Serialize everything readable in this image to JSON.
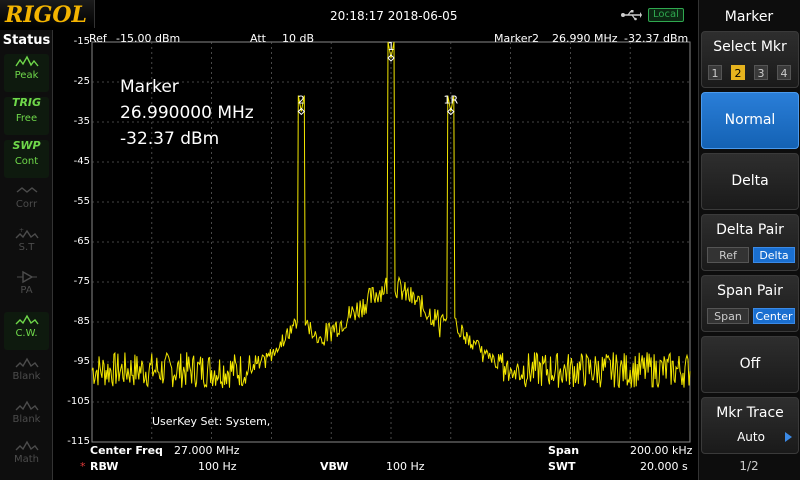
{
  "brand": "RIGOL",
  "datetime": "20:18:17  2018-06-05",
  "remote_status": "Local",
  "status": {
    "title": "Status",
    "items": [
      {
        "icon": "peak-detector-icon",
        "label": "Peak",
        "active": true
      },
      {
        "icon": "TRIG",
        "label": "Free",
        "active": true
      },
      {
        "icon": "SWP",
        "label": "Cont",
        "active": true
      },
      {
        "icon": "correction-icon",
        "label": "Corr",
        "active": false
      },
      {
        "icon": "source-tracking-icon",
        "label": "S.T",
        "active": false
      },
      {
        "icon": "preamp-icon",
        "label": "PA",
        "active": false
      },
      {
        "icon": "cw-signal-icon",
        "label": "C.W.",
        "active": true
      },
      {
        "icon": "blank-trace-icon",
        "label": "Blank",
        "active": false
      },
      {
        "icon": "blank-trace-icon",
        "label": "Blank",
        "active": false
      },
      {
        "icon": "math-trace-icon",
        "label": "Math",
        "active": false
      }
    ]
  },
  "header": {
    "ref_label": "Ref",
    "ref_value": "-15.00 dBm",
    "att_label": "Att",
    "att_value": "10 dB",
    "marker_label": "Marker2",
    "marker_freq": "26.990 MHz",
    "marker_level": "-32.37 dBm"
  },
  "readout": {
    "title": "Marker",
    "freq": "26.990000 MHz",
    "level": "-32.37 dBm"
  },
  "userkey": "UserKey Set:    System,",
  "footer": {
    "center_label": "Center Freq",
    "center_value": "27.000 MHz",
    "span_label": "Span",
    "span_value": "200.00 kHz",
    "rbw_star": "*",
    "rbw_label": "RBW",
    "rbw_value": "100 Hz",
    "vbw_label": "VBW",
    "vbw_value": "100 Hz",
    "swt_label": "SWT",
    "swt_value": "20.000 s"
  },
  "menu": {
    "title": "Marker",
    "select_mkr": {
      "label": "Select Mkr",
      "numbers": [
        "1",
        "2",
        "3",
        "4"
      ],
      "selected": "2"
    },
    "normal": "Normal",
    "delta": "Delta",
    "delta_pair": {
      "label": "Delta Pair",
      "options": [
        "Ref",
        "Delta"
      ],
      "selected": "Delta"
    },
    "span_pair": {
      "label": "Span Pair",
      "options": [
        "Span",
        "Center"
      ],
      "selected": "Center"
    },
    "off": "Off",
    "mkr_trace": {
      "label": "Mkr Trace",
      "value": "Auto"
    },
    "page": "1/2"
  },
  "colors": {
    "trace": "#f2e600",
    "grid": "#5a5a5a",
    "accent": "#1a6fd0",
    "brand": "#f4b400"
  },
  "chart_data": {
    "type": "line",
    "y_tick_labels": [
      "-15",
      "-25",
      "-35",
      "-45",
      "-55",
      "-65",
      "-75",
      "-85",
      "-95",
      "-105",
      "-115"
    ],
    "ylim": [
      -115,
      -15
    ],
    "x_range_mhz": [
      26.9,
      27.1
    ],
    "grid": true,
    "noise_floor_dbm": -97,
    "peaks": [
      {
        "label": "2",
        "freq_mhz": 26.97,
        "level_dbm": -32.37
      },
      {
        "label": "1",
        "freq_mhz": 27.0,
        "level_dbm": -19.0
      },
      {
        "label": "1R",
        "freq_mhz": 27.02,
        "level_dbm": -32.4
      }
    ]
  }
}
